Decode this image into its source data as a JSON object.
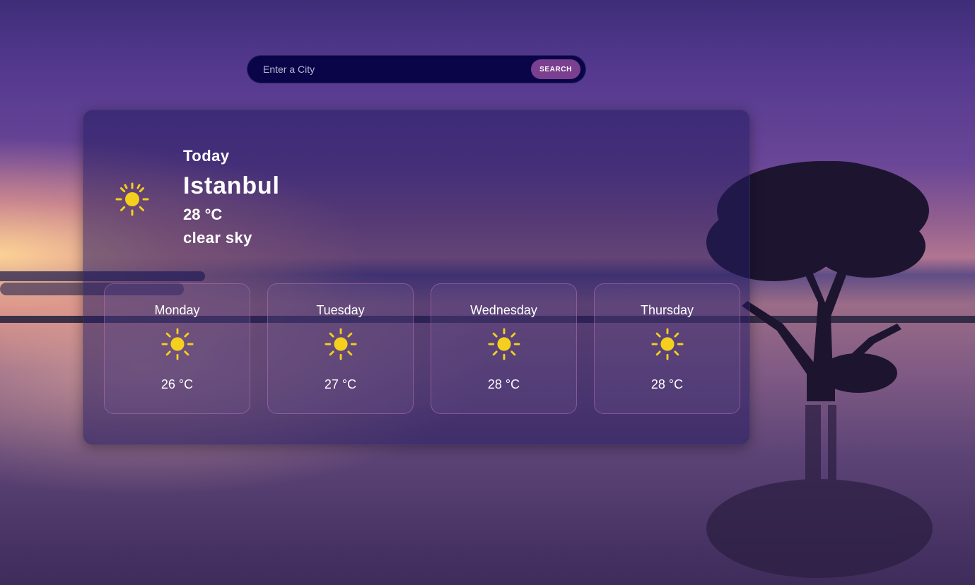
{
  "search": {
    "placeholder": "Enter a City",
    "value": "",
    "button_label": "SEARCH"
  },
  "today": {
    "label": "Today",
    "city": "Istanbul",
    "temperature": "28 °C",
    "description": "clear sky",
    "icon": "sun-icon"
  },
  "forecast": [
    {
      "day": "Monday",
      "temperature": "26 °C",
      "icon": "sun-icon"
    },
    {
      "day": "Tuesday",
      "temperature": "27 °C",
      "icon": "sun-icon"
    },
    {
      "day": "Wednesday",
      "temperature": "28 °C",
      "icon": "sun-icon"
    },
    {
      "day": "Thursday",
      "temperature": "28 °C",
      "icon": "sun-icon"
    }
  ],
  "colors": {
    "search_bg": "#0a0548",
    "search_button": "#7b3f8f",
    "sun": "#f5cf1d",
    "card_bg": "#241c60"
  }
}
